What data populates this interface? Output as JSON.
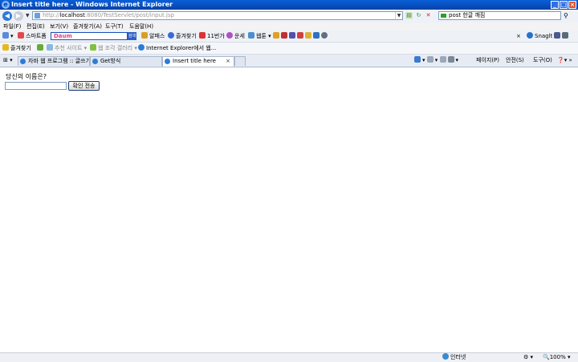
{
  "window": {
    "title": "Insert title here - Windows Internet Explorer",
    "min": "_",
    "max": "□",
    "close": "×"
  },
  "address": {
    "url_prefix": "http://",
    "url_host": "localhost",
    "url_rest": ":8080/TestServlet/post/input.jsp"
  },
  "search": {
    "value": "post 한글 깨짐"
  },
  "menu": [
    "파일(F)",
    "편집(E)",
    "보기(V)",
    "즐겨찾기(A)",
    "도구(T)",
    "도움말(H)"
  ],
  "toolbar": {
    "smartbar": "스마트폼",
    "daum_text": "Daum",
    "daum_go": "검색",
    "items": [
      "알패스",
      "즐겨찾기",
      "11번가",
      "운세",
      "웹툰",
      "Snaglt"
    ]
  },
  "favorites": {
    "label": "즐겨찾기",
    "items": [
      "추천 사이트",
      "웹 조각 갤러리",
      "Internet Explorer에서 웹..."
    ]
  },
  "tabs": [
    {
      "label": "자바 웹 프로그램 :: 글쓰기"
    },
    {
      "label": "Get방식"
    },
    {
      "label": "Insert title here",
      "close": "×"
    }
  ],
  "tab_tools": [
    "페이지(P)",
    "안전(S)",
    "도구(O)"
  ],
  "page": {
    "question": "당신의 이름은?",
    "name_value": "",
    "submit_label": "확인 전송"
  },
  "status": {
    "zone": "인터넷",
    "zoom": "100%"
  }
}
